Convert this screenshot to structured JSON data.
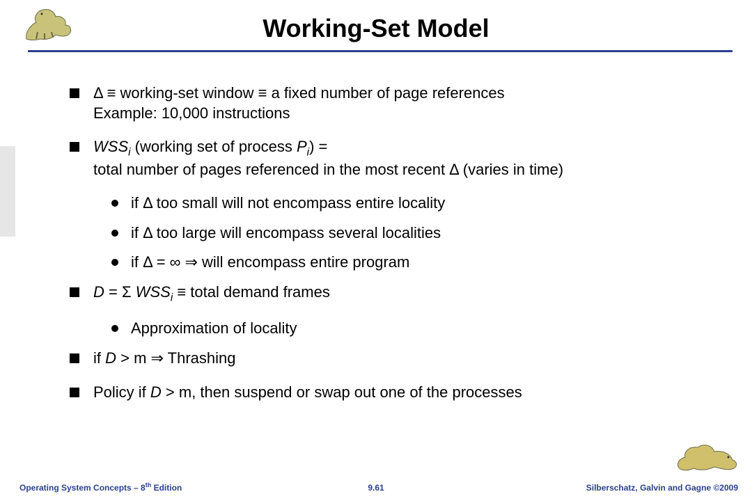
{
  "title": "Working-Set Model",
  "bullets": {
    "b1_line1": "Δ ≡ working-set window ≡ a fixed number of page references",
    "b1_line2": "Example:  10,000 instructions",
    "b2_prefix": "WSS",
    "b2_sub": "i",
    "b2_mid": " (working set of process ",
    "b2_pi": "P",
    "b2_pi_sub": "i",
    "b2_close": ") =",
    "b2_line2": "total number of pages referenced in the most recent Δ (varies in time)",
    "b2a": "if Δ too small will not encompass entire locality",
    "b2b": "if Δ too large will encompass several localities",
    "b2c": "if Δ = ∞ ⇒ will encompass entire program",
    "b3_pre": "D",
    "b3_mid": " = Σ ",
    "b3_wss": "WSS",
    "b3_sub": "i",
    "b3_post": " ≡ total demand frames",
    "b3a": "Approximation of locality",
    "b4_pre": "if ",
    "b4_d": "D",
    "b4_mid": " > m ⇒ Thrashing",
    "b5_pre": "Policy if ",
    "b5_d": "D",
    "b5_post": " > m, then suspend or swap out one of the processes"
  },
  "footer": {
    "left_pre": "Operating System Concepts – 8",
    "left_sup": "th",
    "left_post": " Edition",
    "mid": "9.61",
    "right": "Silberschatz, Galvin and Gagne ©2009"
  }
}
